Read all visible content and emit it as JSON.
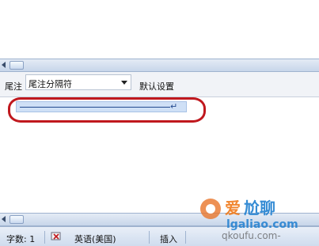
{
  "notes": {
    "label": "尾注",
    "selected": "尾注分隔符",
    "reset_label": "默认设置",
    "paragraph_mark": "↵"
  },
  "status": {
    "word_count": "字数: 1",
    "language": "英语(美国)",
    "insert_mode": "插入"
  },
  "watermark": {
    "text1": "爱",
    "text2": "尬聊",
    "url": "lgaliao.com",
    "url2": "qkoufu.com-"
  }
}
